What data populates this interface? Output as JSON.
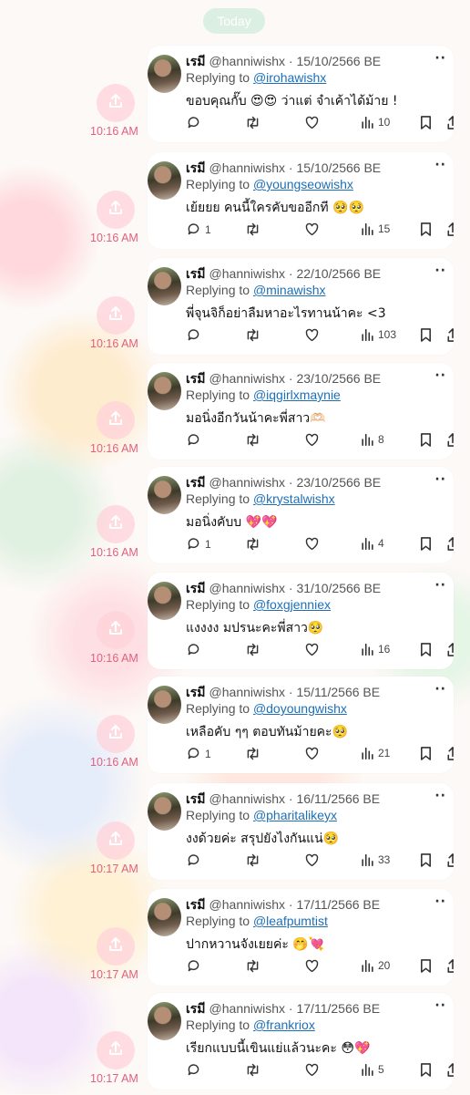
{
  "header": {
    "day_label": "Today"
  },
  "posts": [
    {
      "time": "10:16 AM",
      "name": "เรมี",
      "handle": "@hanniwishx",
      "date": "15/10/2566 BE",
      "replying_label": "Replying to",
      "reply_to": "@irohawishx",
      "text": "ขอบคุณกั๊บ 😍😍 ว่าแต่ จำเค้าได้ม้าย !",
      "replies": "",
      "views": "10"
    },
    {
      "time": "10:16 AM",
      "name": "เรมี",
      "handle": "@hanniwishx",
      "date": "15/10/2566 BE",
      "replying_label": "Replying to",
      "reply_to": "@youngseowishx",
      "text": "เย้ยยย คนนี้ใครคับขออีกที 🥺🥺",
      "replies": "1",
      "views": "15"
    },
    {
      "time": "10:16 AM",
      "name": "เรมี",
      "handle": "@hanniwishx",
      "date": "22/10/2566 BE",
      "replying_label": "Replying to",
      "reply_to": "@minawishx",
      "text": "พี่จุนจิก็อย่าลืมหาอะไรทานน้าคะ <3",
      "replies": "",
      "views": "103"
    },
    {
      "time": "10:16 AM",
      "name": "เรมี",
      "handle": "@hanniwishx",
      "date": "23/10/2566 BE",
      "replying_label": "Replying to",
      "reply_to": "@iqgirlxmaynie",
      "text": "มอนิ่งอีกวันน้าคะพี่สาว🫶🏻",
      "replies": "",
      "views": "8"
    },
    {
      "time": "10:16 AM",
      "name": "เรมี",
      "handle": "@hanniwishx",
      "date": "23/10/2566 BE",
      "replying_label": "Replying to",
      "reply_to": "@krystalwishx",
      "text": "มอนิ่งคับบ 💖💖",
      "replies": "1",
      "views": "4"
    },
    {
      "time": "10:16 AM",
      "name": "เรมี",
      "handle": "@hanniwishx",
      "date": "31/10/2566 BE",
      "replying_label": "Replying to",
      "reply_to": "@foxgjenniex",
      "text": "แงงงง มปรนะคะพี่สาว🥺",
      "replies": "",
      "views": "16"
    },
    {
      "time": "10:16 AM",
      "name": "เรมี",
      "handle": "@hanniwishx",
      "date": "15/11/2566 BE",
      "replying_label": "Replying to",
      "reply_to": "@doyoungwishx",
      "text": "เหลือคับ ๆๆ ตอบทันม้ายคะ🥺",
      "replies": "1",
      "views": "21"
    },
    {
      "time": "10:17 AM",
      "name": "เรมี",
      "handle": "@hanniwishx",
      "date": "16/11/2566 BE",
      "replying_label": "Replying to",
      "reply_to": "@pharitalikeyx",
      "text": "งงด้วยค่ะ สรุปยังไงกันแน่🥺",
      "replies": "",
      "views": "33"
    },
    {
      "time": "10:17 AM",
      "name": "เรมี",
      "handle": "@hanniwishx",
      "date": "17/11/2566 BE",
      "replying_label": "Replying to",
      "reply_to": "@leafpumtist",
      "text": "ปากหวานจังเยยค่ะ 🤭💘",
      "replies": "",
      "views": "20"
    },
    {
      "time": "10:17 AM",
      "name": "เรมี",
      "handle": "@hanniwishx",
      "date": "17/11/2566 BE",
      "replying_label": "Replying to",
      "reply_to": "@frankriox",
      "text": "เรียกแบบนี้เขินแย่แล้วนะคะ 😳💖",
      "replies": "",
      "views": "5"
    }
  ]
}
